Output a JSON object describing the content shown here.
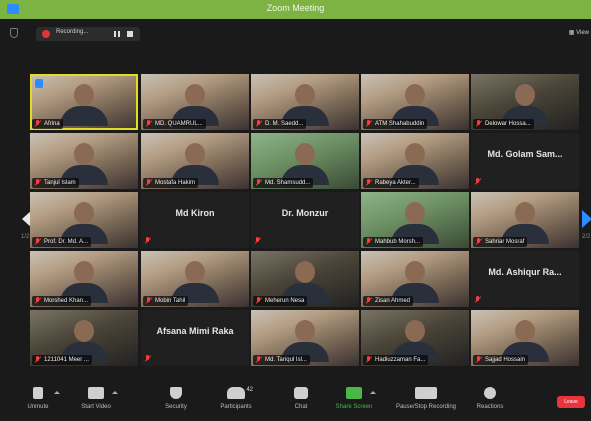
{
  "window": {
    "title": "Zoom Meeting"
  },
  "recording": {
    "status_text": "Recording..."
  },
  "view_label": "View",
  "pagination": {
    "left": "1/2",
    "right": "2/2"
  },
  "participants": [
    {
      "label": "Afrina",
      "big": ""
    },
    {
      "label": "MD. QUAMRUL...",
      "big": ""
    },
    {
      "label": "D. M. Saedd...",
      "big": ""
    },
    {
      "label": "ATM Shahabuddin",
      "big": ""
    },
    {
      "label": "Delowar Hossa...",
      "big": ""
    },
    {
      "label": "Tanjul Islam",
      "big": ""
    },
    {
      "label": "Mostafa Hakim",
      "big": ""
    },
    {
      "label": "Md. Shamsudd...",
      "big": ""
    },
    {
      "label": "Rabeya Akter...",
      "big": ""
    },
    {
      "label": "",
      "big": "Md. Golam Sam..."
    },
    {
      "label": "Prof. Dr. Md. A...",
      "big": ""
    },
    {
      "label": "",
      "big": "Md Kiron"
    },
    {
      "label": "",
      "big": "Dr. Monzur"
    },
    {
      "label": "Mahbub Morsh...",
      "big": ""
    },
    {
      "label": "Sahriar Mosraf",
      "big": ""
    },
    {
      "label": "Morshed Khan...",
      "big": ""
    },
    {
      "label": "Mobin Tahil",
      "big": ""
    },
    {
      "label": "Meherun Nesa",
      "big": ""
    },
    {
      "label": "Zisan Ahmed",
      "big": ""
    },
    {
      "label": "",
      "big": "Md. Ashiqur Ra..."
    },
    {
      "label": "1211041 Meer ...",
      "big": ""
    },
    {
      "label": "",
      "big": "Afsana Mimi Raka"
    },
    {
      "label": "Md. Tariqul Isl...",
      "big": ""
    },
    {
      "label": "Hadiuzzaman Fa...",
      "big": ""
    },
    {
      "label": "Sajjad Hossain",
      "big": ""
    }
  ],
  "toolbar": {
    "unmute": "Unmute",
    "start_video": "Start Video",
    "security": "Security",
    "participants": "Participants",
    "participants_count": "42",
    "chat": "Chat",
    "share_screen": "Share Screen",
    "pause_stop_recording": "Pause/Stop Recording",
    "reactions": "Reactions",
    "leave": "Leave"
  }
}
